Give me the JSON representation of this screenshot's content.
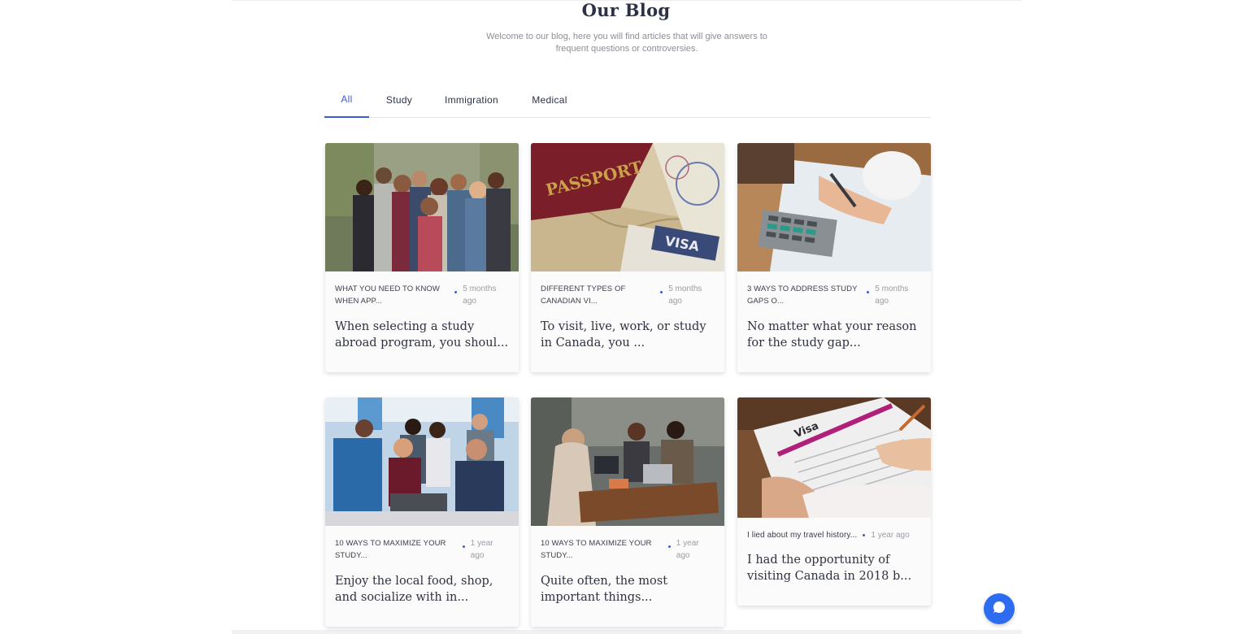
{
  "header": {
    "title": "Our Blog",
    "subtitle": "Welcome to our blog, here you will find articles that will give answers to frequent questions or controversies."
  },
  "tabs": [
    {
      "label": "All",
      "active": true
    },
    {
      "label": "Study",
      "active": false
    },
    {
      "label": "Immigration",
      "active": false
    },
    {
      "label": "Medical",
      "active": false
    }
  ],
  "posts": [
    {
      "category": "WHAT YOU NEED TO KNOW WHEN APP...",
      "time": "5 months ago",
      "excerpt": "When selecting a study abroad program, you shoul..."
    },
    {
      "category": "DIFFERENT TYPES OF CANADIAN VI...",
      "time": "5 months ago",
      "excerpt": " To visit, live, work, or study in Canada, you ..."
    },
    {
      "category": "3 WAYS TO ADDRESS STUDY GAPS O...",
      "time": "5 months ago",
      "excerpt": "No matter what your reason for the study gap..."
    },
    {
      "category": "10 WAYS TO MAXIMIZE YOUR STUDY...",
      "time": "1 year ago",
      "excerpt": "Enjoy the local food, shop, and socialize with in..."
    },
    {
      "category": "10 WAYS TO MAXIMIZE YOUR STUDY...",
      "time": "1 year ago",
      "excerpt": "Quite often, the most important things..."
    },
    {
      "category": "I lied about my travel history...",
      "time": "1 year ago",
      "excerpt": "I had the opportunity of visiting Canada in 2018 b..."
    }
  ],
  "image_text": {
    "passport": "PASSPORT",
    "visa": "VISA",
    "visa_application": "Visa"
  },
  "colors": {
    "accent": "#3b5bdb",
    "chat": "#2d6cf0"
  },
  "icons": {
    "chat": "chat-bubble-icon"
  }
}
